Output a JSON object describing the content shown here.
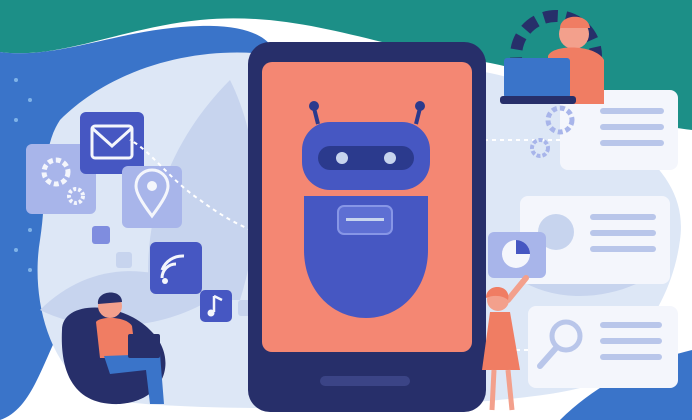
{
  "illustration": {
    "subject": "chatbot-automation-illustration",
    "colors": {
      "teal": "#1c8f87",
      "blue": "#3a74c9",
      "sky": "#dde7f6",
      "leaf": "#c7d4ee",
      "phone_frame": "#272f6a",
      "screen": "#f48773",
      "robot": "#4657c2",
      "robot_dark": "#2b3a8d",
      "tile": "#7f8ddf",
      "card": "#f4f6fc",
      "line": "#b9c6ea",
      "skin": "#f3a08c",
      "shirt": "#f07d63"
    },
    "icons": [
      "gear-icon",
      "mail-icon",
      "location-pin-icon",
      "wifi-icon",
      "music-note-icon",
      "pie-chart-icon",
      "magnifier-icon",
      "laptop-icon"
    ]
  }
}
